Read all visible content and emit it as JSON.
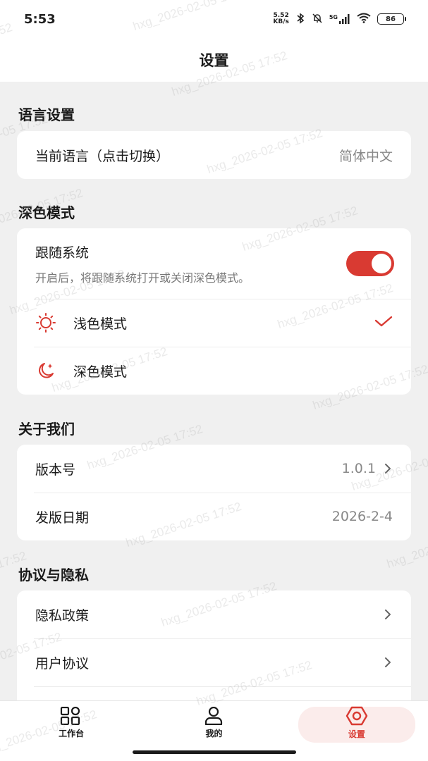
{
  "status_bar": {
    "time": "5:53",
    "net_speed_value": "5.52",
    "net_speed_unit": "KB/s",
    "network_type": "5G",
    "battery": "86"
  },
  "header": {
    "title": "设置"
  },
  "language": {
    "section_title": "语言设置",
    "current_label": "当前语言（点击切换）",
    "current_value": "简体中文"
  },
  "dark_mode": {
    "section_title": "深色模式",
    "follow_system_label": "跟随系统",
    "follow_system_desc": "开启后，将跟随系统打开或关闭深色模式。",
    "follow_system_on": true,
    "light_label": "浅色模式",
    "dark_label": "深色模式",
    "selected": "light"
  },
  "about": {
    "section_title": "关于我们",
    "version_label": "版本号",
    "version_value": "1.0.1",
    "release_label": "发版日期",
    "release_value": "2026-2-4"
  },
  "privacy": {
    "section_title": "协议与隐私",
    "policy_label": "隐私政策",
    "agreement_label": "用户协议"
  },
  "tabbar": {
    "tabs": [
      {
        "label": "工作台",
        "icon": "grid-icon"
      },
      {
        "label": "我的",
        "icon": "user-icon"
      },
      {
        "label": "设置",
        "icon": "settings-hexagon-icon"
      }
    ],
    "active": 2
  },
  "watermark": {
    "text": "hxg_2026-02-05 17:52"
  },
  "colors": {
    "accent": "#d93a32",
    "background": "#f0f0f0",
    "card": "#ffffff"
  }
}
